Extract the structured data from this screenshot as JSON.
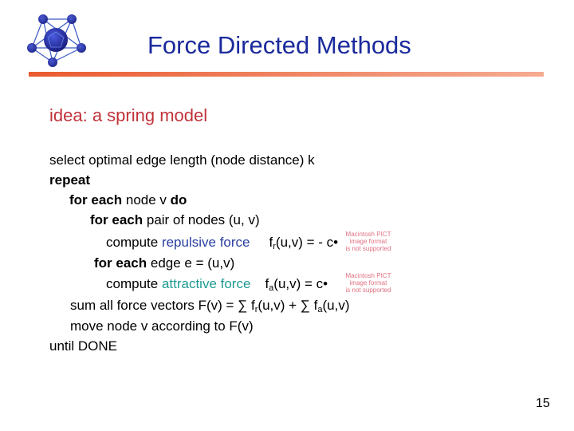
{
  "slide": {
    "title": "Force Directed Methods",
    "subtitle": "idea:  a spring model",
    "page_number": "15",
    "colors": {
      "title": "#1a2a9c",
      "subtitle": "#c0323a",
      "repulsive": "#2a3ea0",
      "attractive": "#1e9a92",
      "rule_start": "#ea5a2e",
      "rule_end": "#f6ab92"
    },
    "logo_icon": "graph-network-icon"
  },
  "algorithm": {
    "l1": "select optimal edge length  (node distance)   k",
    "l2_kw": "repeat",
    "l3_kw1": "for each",
    "l3_text": " node  v  ",
    "l3_kw2": "do",
    "l4_kw": "for each",
    "l4_text": " pair of nodes  (u, v)",
    "l5_pre": "compute ",
    "l5_colored": "repulsive force",
    "l5_f": "f",
    "l5_sub": "r",
    "l5_rest": "(u,v) = - c•",
    "l6_kw": "for each",
    "l6_text": " edge  e = (u,v)",
    "l7_pre": "compute ",
    "l7_colored": "attractive force",
    "l7_f": "f",
    "l7_sub": "a",
    "l7_rest": "(u,v) = c•",
    "l8_pre": "sum all force vectors  F(v) = ∑ f",
    "l8_sub1": "r",
    "l8_mid": "(u,v) + ∑ f",
    "l8_sub2": "a",
    "l8_end": "(u,v)",
    "l9": "move  node  v  according to F(v)",
    "l10": "until  DONE"
  },
  "placeholders": {
    "pict_line1": "Macintosh PICT",
    "pict_line2": "image format",
    "pict_line3": "is not supported"
  }
}
